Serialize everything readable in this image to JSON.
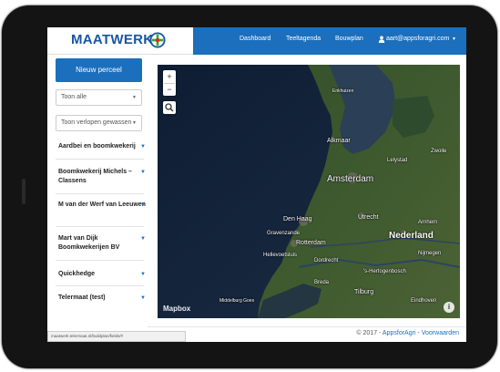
{
  "header": {
    "logo_text": "MAATWERK",
    "nav": [
      "Dashboard",
      "Teeltagenda",
      "Bouwplan"
    ],
    "user_email": "aart@appsforagri.com"
  },
  "colors": {
    "primary": "#1b6fbd",
    "logo": "#1a56a0",
    "logo_accent_green": "#3aaa35",
    "logo_accent_red": "#d62b2b"
  },
  "sidebar": {
    "new_button": "Nieuw perceel",
    "filter_select": "Toon alle",
    "crops_select": "Toon verlopen gewassen",
    "farms": [
      "Aardbei en boomkwekerij",
      "Boomkwekerij Michels – Classens",
      "M van der Werf van Leeuwen",
      "Mart van Dijk Boomkwekerijen BV",
      "Quickhedge",
      "Telermaat (test)"
    ]
  },
  "map": {
    "attribution": "Mapbox",
    "info": "i",
    "zoom_in": "+",
    "zoom_out": "−",
    "places": {
      "alkmaar": "Alkmaar",
      "lelystad": "Lelystad",
      "amsterdam": "Amsterdam",
      "zwolle": "Zwolle",
      "den_haag": "Den Haag",
      "utrecht": "Utrecht",
      "arnhem": "Arnhem",
      "nederland": "Nederland",
      "gravenzande": "Gravenzande",
      "rotterdam": "Rotterdam",
      "hellevoetsluis": "Hellevoetsluis",
      "dordrecht": "Dordrecht",
      "nijmegen": "Nijmegen",
      "hertogenbosch": "'s-Hertogenbosch",
      "tilburg": "Tilburg",
      "breda": "Breda",
      "middelburg": "Middelburg Goes",
      "eindhoven": "Eindhoven",
      "enkhuizen": "Enkhuizen"
    }
  },
  "footer": {
    "copyright": "© 2017 - ",
    "brand": "AppsforAgri",
    "sep": " - ",
    "terms": "Voorwaarden"
  },
  "statusbar": {
    "url": "maatwerk.telermaat.nl/buildplan/fields/#"
  }
}
